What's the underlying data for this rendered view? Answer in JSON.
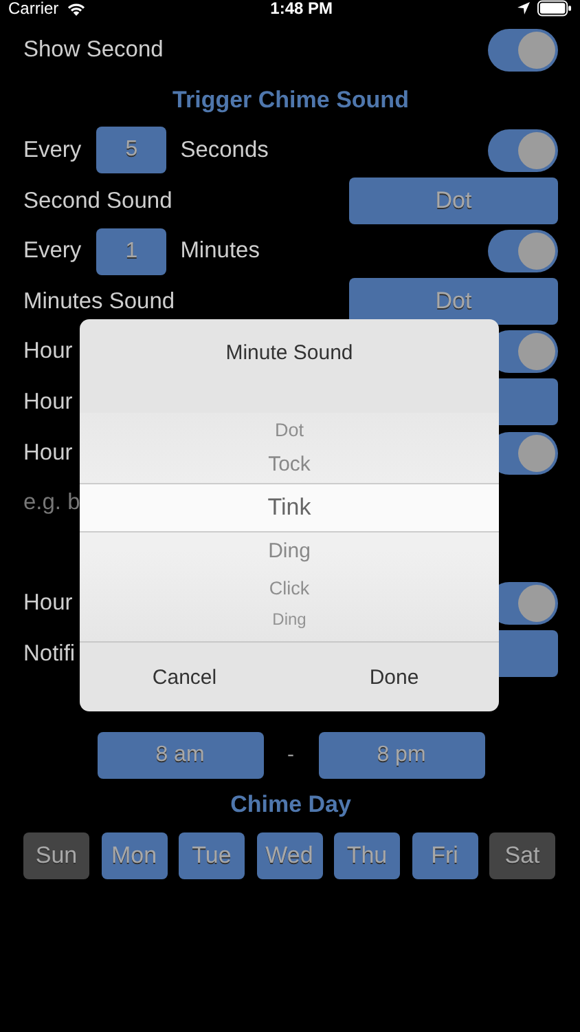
{
  "status_bar": {
    "carrier": "Carrier",
    "time": "1:48 PM"
  },
  "rows": [
    {
      "kind": "toggle",
      "label": "Show Second",
      "on": true
    },
    {
      "kind": "heading",
      "label": "Trigger Chime Sound"
    },
    {
      "kind": "interval",
      "prefix": "Every",
      "value": "5",
      "unit": "Seconds",
      "on": true
    },
    {
      "kind": "select",
      "label": "Second Sound",
      "value": "Dot"
    },
    {
      "kind": "interval",
      "prefix": "Every",
      "value": "1",
      "unit": "Minutes",
      "on": true
    },
    {
      "kind": "select",
      "label": "Minutes Sound",
      "value": "Dot"
    },
    {
      "kind": "toggle",
      "label": "Hour",
      "on": true
    },
    {
      "kind": "select",
      "label": "Hour"
    },
    {
      "kind": "toggle",
      "label": "Hour",
      "on": true
    },
    {
      "kind": "note",
      "label": "e.g. b"
    },
    {
      "kind": "spacer"
    },
    {
      "kind": "toggle",
      "label": "Hour",
      "on": true
    },
    {
      "kind": "select",
      "label": "Notifi"
    },
    {
      "kind": "spacer"
    },
    {
      "kind": "range",
      "from": "8 am",
      "separator": "-",
      "to": "8 pm"
    },
    {
      "kind": "heading",
      "label": "Chime Day"
    },
    {
      "kind": "days",
      "days": [
        {
          "label": "Sun",
          "selected": false
        },
        {
          "label": "Mon",
          "selected": true
        },
        {
          "label": "Tue",
          "selected": true
        },
        {
          "label": "Wed",
          "selected": true
        },
        {
          "label": "Thu",
          "selected": true
        },
        {
          "label": "Fri",
          "selected": true
        },
        {
          "label": "Sat",
          "selected": false
        }
      ]
    }
  ],
  "dialog": {
    "title": "Minute Sound",
    "options": [
      {
        "label": "Dot",
        "selected": false
      },
      {
        "label": "Tock",
        "selected": false
      },
      {
        "label": "Tink",
        "selected": true
      },
      {
        "label": "Ding",
        "selected": false
      },
      {
        "label": "Click",
        "selected": false
      },
      {
        "label": "Ding",
        "selected": false
      }
    ],
    "buttons": [
      "Cancel",
      "Done"
    ]
  }
}
